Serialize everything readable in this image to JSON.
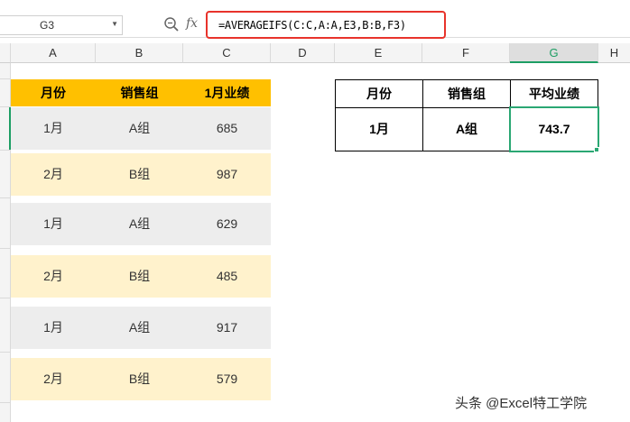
{
  "formula_bar": {
    "name_box": "G3",
    "fx_label": "fx",
    "formula": "=AVERAGEIFS(C:C,A:A,E3,B:B,F3)"
  },
  "columns": [
    "A",
    "B",
    "C",
    "D",
    "E",
    "F",
    "G",
    "H"
  ],
  "active_column": "G",
  "left_table": {
    "headers": [
      "月份",
      "销售组",
      "1月业绩"
    ],
    "rows": [
      [
        "1月",
        "A组",
        "685"
      ],
      [
        "2月",
        "B组",
        "987"
      ],
      [
        "1月",
        "A组",
        "629"
      ],
      [
        "2月",
        "B组",
        "485"
      ],
      [
        "1月",
        "A组",
        "917"
      ],
      [
        "2月",
        "B组",
        "579"
      ]
    ]
  },
  "right_table": {
    "headers": [
      "月份",
      "销售组",
      "平均业绩"
    ],
    "values": [
      "1月",
      "A组",
      "743.7"
    ]
  },
  "watermark": "头条 @Excel特工学院",
  "colors": {
    "header_fill": "#ffc000",
    "row_grey": "#ededed",
    "row_cream": "#fff2cc",
    "selection": "#2aa773",
    "formula_highlight": "#e8332b"
  }
}
